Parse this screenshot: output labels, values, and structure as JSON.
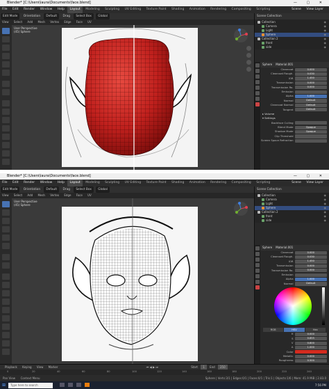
{
  "window_title": "Blender* [C:\\Users\\laura\\Documents\\face.blend]",
  "menu": {
    "items": [
      "File",
      "Edit",
      "Render",
      "Window",
      "Help"
    ],
    "workspaces": [
      "Layout",
      "Modeling",
      "Sculpting",
      "UV Editing",
      "Texture Paint",
      "Shading",
      "Animation",
      "Rendering",
      "Compositing",
      "Scripting"
    ],
    "active_workspace": "Layout",
    "scene": "Scene",
    "view_layer": "View Layer"
  },
  "header": {
    "mode": "Edit Mode",
    "items": [
      "View",
      "Select",
      "Add",
      "Mesh",
      "Vertex",
      "Edge",
      "Face",
      "UV"
    ],
    "orientation": "Orientation",
    "orientation_value": "Default",
    "drag": "Drag",
    "drag_value": "Select Box",
    "transform": "Global"
  },
  "viewport": {
    "line1": "User Perspective",
    "line2": "(45) Sphere"
  },
  "outliner": {
    "header": "Scene Collection",
    "top_items": [
      {
        "label": "Collection",
        "color": "#bbbbbb"
      },
      {
        "label": "Camera",
        "color": "#6aa36a"
      },
      {
        "label": "Light",
        "color": "#6aa36a"
      },
      {
        "label": "Sphere",
        "color": "#e89030"
      },
      {
        "label": "Collection 2",
        "color": "#bbbbbb"
      },
      {
        "label": "front",
        "color": "#6aa36a"
      },
      {
        "label": "side",
        "color": "#6aa36a"
      }
    ],
    "bottom_items": [
      {
        "label": "Collection",
        "color": "#bbbbbb"
      },
      {
        "label": "Camera",
        "color": "#6aa36a"
      },
      {
        "label": "Light",
        "color": "#6aa36a"
      },
      {
        "label": "Sphere",
        "color": "#e89030"
      },
      {
        "label": "Collection 2",
        "color": "#bbbbbb"
      },
      {
        "label": "front",
        "color": "#6aa36a"
      },
      {
        "label": "side",
        "color": "#6aa36a"
      }
    ]
  },
  "material": {
    "object": "Sphere",
    "name": "Material.001",
    "rows": [
      {
        "label": "Clearcoat",
        "value": "0.000"
      },
      {
        "label": "Clearcoat Rough.",
        "value": "0.030"
      },
      {
        "label": "IOR",
        "value": "1.450"
      },
      {
        "label": "Transmission",
        "value": "0.000"
      },
      {
        "label": "Transmission Ro.",
        "value": "0.000"
      },
      {
        "label": "Emission",
        "value": ""
      },
      {
        "label": "Alpha",
        "value": "1.000"
      },
      {
        "label": "Normal",
        "value": "Default"
      },
      {
        "label": "Clearcoat Normal",
        "value": "Default"
      },
      {
        "label": "Tangent",
        "value": "Default"
      }
    ],
    "sections": [
      "Volume",
      "Settings"
    ],
    "settings_rows": [
      {
        "label": "Backface Culling",
        "value": ""
      },
      {
        "label": "Blend Mode",
        "value": "Opaque"
      },
      {
        "label": "Shadow Mode",
        "value": "Opaque"
      },
      {
        "label": "Clip Threshold",
        "value": ""
      },
      {
        "label": "Screen Space Refraction",
        "value": ""
      }
    ],
    "color_rows": [
      {
        "label": "H",
        "value": "0.000"
      },
      {
        "label": "S",
        "value": "0.855"
      },
      {
        "label": "V",
        "value": "0.800"
      },
      {
        "label": "A",
        "value": "1.000"
      }
    ],
    "color_modes": [
      "RGB",
      "HSV",
      "Hex"
    ],
    "bottom_rows": [
      {
        "label": "Color",
        "value": ""
      },
      {
        "label": "Metallic",
        "value": "0.000"
      },
      {
        "label": "Roughness",
        "value": "0.500"
      }
    ]
  },
  "timeline": {
    "items": [
      "Playback",
      "Keying",
      "View",
      "Marker"
    ],
    "ticks": [
      "0",
      "20",
      "40",
      "60",
      "80",
      "100",
      "120",
      "140",
      "160",
      "180",
      "200",
      "220",
      "240"
    ],
    "start_label": "Start",
    "start": "1",
    "end_label": "End",
    "end": "250"
  },
  "statusbar": {
    "left": "Pan View",
    "mid": "Context Menu",
    "stats": "Sphere | Verts:3/1 | Edges:0/1 | Faces:0/1 | Tris:1 | Objects:1/6 | Mem: 41.9 MiB | 2.83.0"
  },
  "taskbar": {
    "search": "Type here to search",
    "time": "7:56 PM"
  },
  "colors": {
    "accent": "#4772b3",
    "sphere_red": "#c0201d",
    "color_swatch": "#d42b1f"
  }
}
